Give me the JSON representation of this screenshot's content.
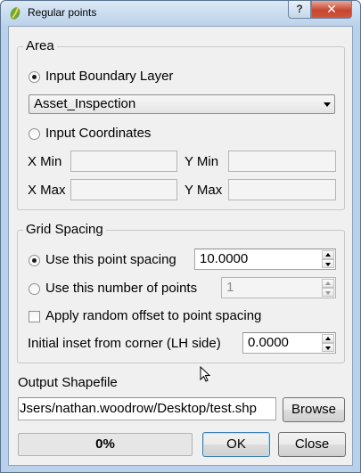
{
  "window": {
    "title": "Regular points",
    "help_glyph": "?",
    "close_glyph": "✕"
  },
  "area": {
    "title": "Area",
    "input_boundary_layer": {
      "label": "Input Boundary Layer",
      "checked": true
    },
    "layer_combo": {
      "value": "Asset_Inspection"
    },
    "input_coordinates": {
      "label": "Input Coordinates",
      "checked": false
    },
    "x_min": {
      "label": "X Min",
      "value": ""
    },
    "y_min": {
      "label": "Y Min",
      "value": ""
    },
    "x_max": {
      "label": "X Max",
      "value": ""
    },
    "y_max": {
      "label": "Y Max",
      "value": ""
    }
  },
  "grid": {
    "title": "Grid Spacing",
    "use_spacing": {
      "label": "Use this point spacing",
      "checked": true,
      "value": "10.0000"
    },
    "use_number": {
      "label": "Use this number of points",
      "checked": false,
      "value": "1"
    },
    "random_offset": {
      "label": "Apply random offset to point spacing",
      "checked": false
    },
    "inset": {
      "label": "Initial inset from corner (LH side)",
      "value": "0.0000"
    }
  },
  "output": {
    "label": "Output Shapefile",
    "path": "Jsers/nathan.woodrow/Desktop/test.shp",
    "browse_label": "Browse"
  },
  "footer": {
    "progress_text": "0%",
    "progress_value": 0,
    "ok_label": "OK",
    "close_label": "Close"
  }
}
